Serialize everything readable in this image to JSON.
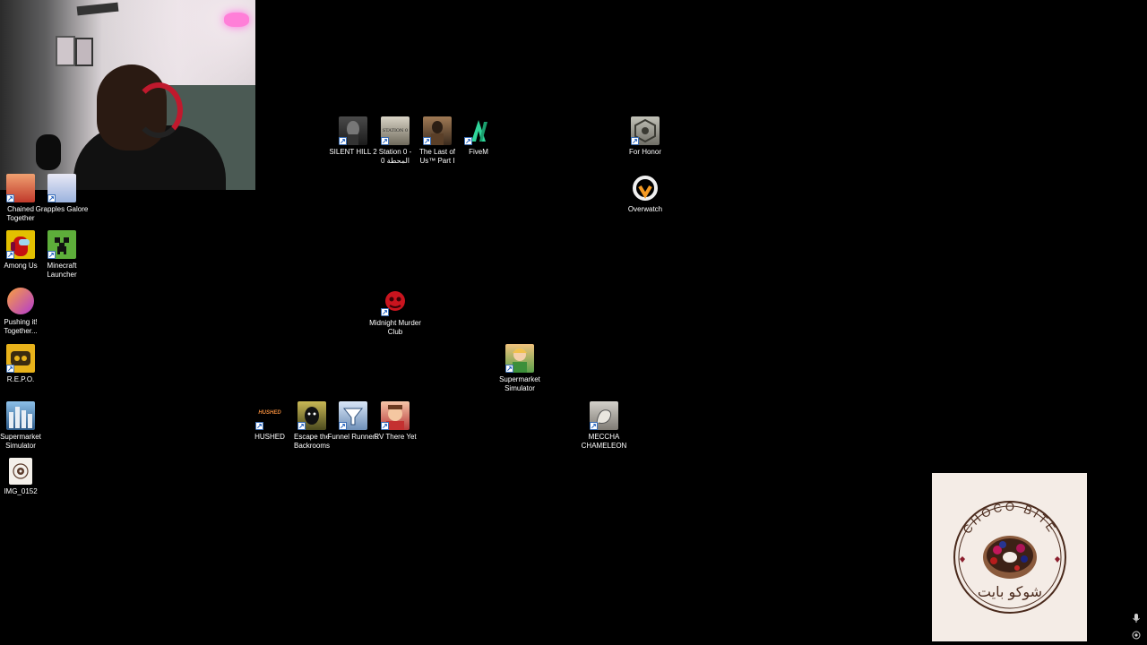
{
  "desktop": {
    "icons": {
      "silent_hill": "SILENT HILL 2",
      "station0": "Station 0 - المحطة 0",
      "last_of_us": "The Last of Us™ Part I",
      "fivem": "FiveM",
      "for_honor": "For Honor",
      "overwatch": "Overwatch",
      "chained_together": "Chained Together",
      "grapples_galore": "Grapples Galore",
      "among_us": "Among Us",
      "minecraft_launcher": "Minecraft Launcher",
      "pushing_it_together": "Pushing it! Together...",
      "repo": "R.E.P.O.",
      "supermarket_simulator_left": "Supermarket Simulator",
      "img_0152": "IMG_0152",
      "midnight_murder_club": "Midnight Murder Club",
      "supermarket_simulator_center": "Supermarket Simulator",
      "hushed": "HUSHED",
      "escape_backrooms": "Escape the Backrooms",
      "funnel_runners": "Funnel Runners",
      "rv_there_yet": "RV There Yet",
      "meccha_chameleon": "MECCHA CHAMELEON"
    },
    "icon_art_text": {
      "station0_banner": "STATION 0",
      "hushed_banner": "HUSHED"
    }
  },
  "overlay": {
    "logo_top_text": "CHOCO BITE",
    "logo_bottom_text": "شوكو بايت"
  },
  "colors": {
    "background": "#000000",
    "logo_card": "#f4ece6",
    "logo_brown": "#4a2a1c",
    "shortcut_arrow": "#1f5fbf"
  }
}
